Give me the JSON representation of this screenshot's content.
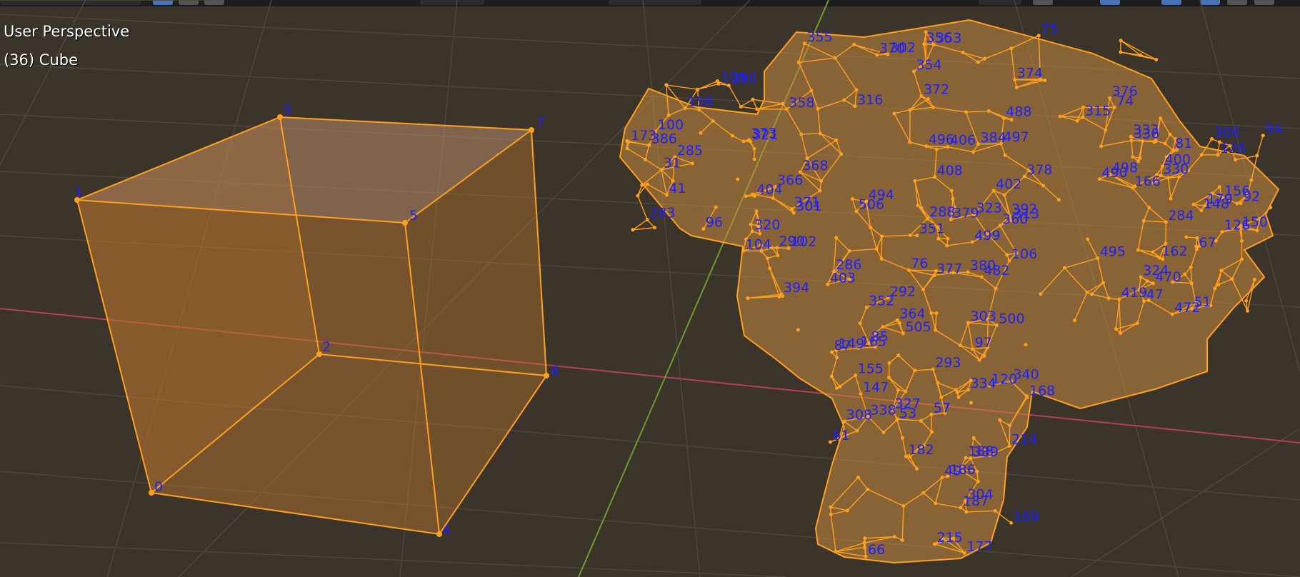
{
  "overlay": {
    "view_name": "User Perspective",
    "object_info": "(36) Cube"
  },
  "colors": {
    "background": "#3a342b",
    "grid": "#4d473f",
    "x_axis": "#b3434f",
    "y_axis": "#6d9a2c",
    "selection_orange": "#ffa01e",
    "vertex_index_blue": "#2020ff"
  },
  "cube_vertex_labels": [
    "0",
    "1",
    "2",
    "3",
    "4",
    "5",
    "6",
    "7"
  ],
  "suzanne_vertex_labels": [
    "74",
    "354",
    "356",
    "302",
    "353",
    "355",
    "374",
    "372",
    "75",
    "376",
    "370",
    "316",
    "358",
    "366",
    "378",
    "301",
    "315",
    "373",
    "371",
    "496",
    "494",
    "404",
    "400",
    "406",
    "498",
    "408",
    "402",
    "497",
    "490",
    "488",
    "506",
    "368",
    "384",
    "324",
    "76",
    "377",
    "505",
    "499",
    "403",
    "495",
    "500",
    "470",
    "394",
    "482",
    "380",
    "364",
    "288",
    "104",
    "323",
    "286",
    "379",
    "313",
    "472",
    "419",
    "392",
    "360",
    "290",
    "303",
    "102",
    "352",
    "292",
    "106",
    "351",
    "173",
    "321",
    "285",
    "105",
    "100",
    "41",
    "31",
    "158",
    "283",
    "390",
    "96",
    "320",
    "386",
    "156",
    "126",
    "179",
    "128",
    "284",
    "150",
    "148",
    "92",
    "94",
    "81",
    "330",
    "336",
    "166",
    "306",
    "333",
    "334",
    "340",
    "168",
    "85",
    "87",
    "120",
    "97",
    "155",
    "293",
    "149",
    "147",
    "165",
    "327",
    "308",
    "304",
    "215",
    "214",
    "338",
    "187",
    "188",
    "186",
    "339",
    "182",
    "169",
    "177",
    "61",
    "66",
    "49",
    "57",
    "53",
    "51",
    "47",
    "67",
    "162"
  ]
}
